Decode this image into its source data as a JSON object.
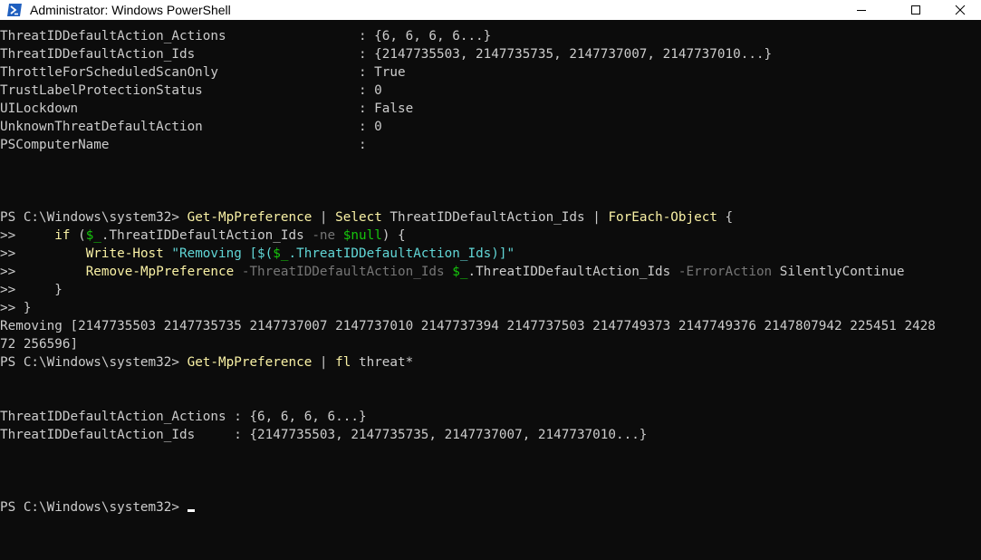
{
  "window": {
    "title": "Administrator: Windows PowerShell",
    "icon": "powershell-icon",
    "controls": [
      "minimize-icon",
      "maximize-icon",
      "close-icon"
    ]
  },
  "colors": {
    "background": "#0c0c0c",
    "foreground": "#cccccc",
    "command": "#f9f1a5",
    "variable": "#16c60c",
    "string": "#61d6d6",
    "parameter": "#767676",
    "titlebar": "#ffffff"
  },
  "console": {
    "lines": [
      [
        {
          "t": "ThreatIDDefaultAction_Actions                 : {6, 6, 6, 6...}",
          "c": "def"
        }
      ],
      [
        {
          "t": "ThreatIDDefaultAction_Ids                     : {2147735503, 2147735735, 2147737007, 2147737010...}",
          "c": "def"
        }
      ],
      [
        {
          "t": "ThrottleForScheduledScanOnly                  : True",
          "c": "def"
        }
      ],
      [
        {
          "t": "TrustLabelProtectionStatus                    : 0",
          "c": "def"
        }
      ],
      [
        {
          "t": "UILockdown                                    : False",
          "c": "def"
        }
      ],
      [
        {
          "t": "UnknownThreatDefaultAction                    : 0",
          "c": "def"
        }
      ],
      [
        {
          "t": "PSComputerName                                :",
          "c": "def"
        }
      ],
      [],
      [],
      [],
      [
        {
          "t": "PS C:\\Windows\\system32> ",
          "c": "def"
        },
        {
          "t": "Get-MpPreference",
          "c": "cmd"
        },
        {
          "t": " | ",
          "c": "def"
        },
        {
          "t": "Select",
          "c": "cmd"
        },
        {
          "t": " ThreatIDDefaultAction_Ids | ",
          "c": "def"
        },
        {
          "t": "ForEach-Object",
          "c": "cmd"
        },
        {
          "t": " {",
          "c": "def"
        }
      ],
      [
        {
          "t": ">>     ",
          "c": "def"
        },
        {
          "t": "if",
          "c": "cmd"
        },
        {
          "t": " (",
          "c": "def"
        },
        {
          "t": "$_",
          "c": "var"
        },
        {
          "t": ".ThreatIDDefaultAction_Ids ",
          "c": "def"
        },
        {
          "t": "-ne",
          "c": "par"
        },
        {
          "t": " ",
          "c": "def"
        },
        {
          "t": "$null",
          "c": "var"
        },
        {
          "t": ") {",
          "c": "def"
        }
      ],
      [
        {
          "t": ">>         ",
          "c": "def"
        },
        {
          "t": "Write-Host",
          "c": "cmd"
        },
        {
          "t": " ",
          "c": "def"
        },
        {
          "t": "\"Removing [$(",
          "c": "str"
        },
        {
          "t": "$_",
          "c": "var"
        },
        {
          "t": ".ThreatIDDefaultAction_Ids)]\"",
          "c": "str"
        }
      ],
      [
        {
          "t": ">>         ",
          "c": "def"
        },
        {
          "t": "Remove-MpPreference",
          "c": "cmd"
        },
        {
          "t": " ",
          "c": "def"
        },
        {
          "t": "-ThreatIDDefaultAction_Ids",
          "c": "par"
        },
        {
          "t": " ",
          "c": "def"
        },
        {
          "t": "$_",
          "c": "var"
        },
        {
          "t": ".ThreatIDDefaultAction_Ids ",
          "c": "def"
        },
        {
          "t": "-ErrorAction",
          "c": "par"
        },
        {
          "t": " SilentlyContinue",
          "c": "def"
        }
      ],
      [
        {
          "t": ">>     }",
          "c": "def"
        }
      ],
      [
        {
          "t": ">> }",
          "c": "def"
        }
      ],
      [
        {
          "t": "Removing [2147735503 2147735735 2147737007 2147737010 2147737394 2147737503 2147749373 2147749376 2147807942 225451 2428",
          "c": "def"
        }
      ],
      [
        {
          "t": "72 256596]",
          "c": "def"
        }
      ],
      [
        {
          "t": "PS C:\\Windows\\system32> ",
          "c": "def"
        },
        {
          "t": "Get-MpPreference",
          "c": "cmd"
        },
        {
          "t": " | ",
          "c": "def"
        },
        {
          "t": "fl",
          "c": "cmd"
        },
        {
          "t": " threat*",
          "c": "def"
        }
      ],
      [],
      [],
      [
        {
          "t": "ThreatIDDefaultAction_Actions : {6, 6, 6, 6...}",
          "c": "def"
        }
      ],
      [
        {
          "t": "ThreatIDDefaultAction_Ids     : {2147735503, 2147735735, 2147737007, 2147737010...}",
          "c": "def"
        }
      ],
      [],
      [],
      [],
      [
        {
          "t": "PS C:\\Windows\\system32> ",
          "c": "def"
        }
      ]
    ]
  }
}
